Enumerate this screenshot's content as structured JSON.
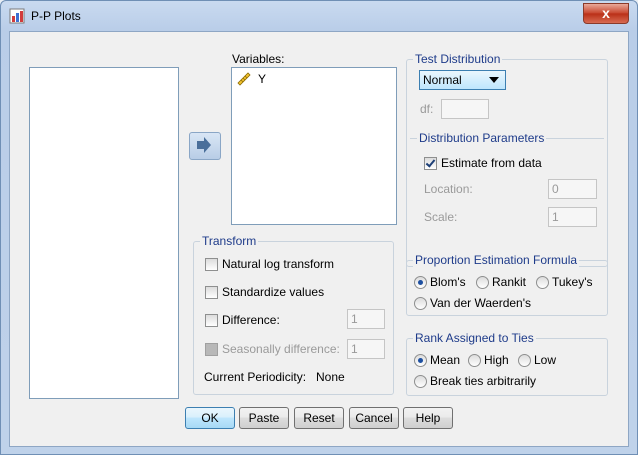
{
  "window": {
    "title": "P-P Plots",
    "close_label": "x"
  },
  "variables": {
    "label": "Variables:",
    "items": [
      {
        "name": "Y"
      }
    ]
  },
  "transform": {
    "legend": "Transform",
    "natural_log": {
      "label": "Natural log transform",
      "checked": false
    },
    "standardize": {
      "label": "Standardize values",
      "checked": false
    },
    "difference": {
      "label": "Difference:",
      "checked": false,
      "value": "1"
    },
    "seasonal": {
      "label": "Seasonally difference:",
      "checked": false,
      "value": "1",
      "disabled": true
    },
    "periodicity_label": "Current Periodicity:",
    "periodicity_value": "None"
  },
  "test_distribution": {
    "legend": "Test Distribution",
    "selected": "Normal",
    "df_label": "df:",
    "df_value": "",
    "params_legend": "Distribution Parameters",
    "estimate": {
      "label": "Estimate from data",
      "checked": true
    },
    "location_label": "Location:",
    "location_value": "0",
    "scale_label": "Scale:",
    "scale_value": "1"
  },
  "proportion": {
    "legend": "Proportion Estimation Formula",
    "options": [
      "Blom's",
      "Rankit",
      "Tukey's",
      "Van der Waerden's"
    ],
    "selected": "Blom's"
  },
  "ties": {
    "legend": "Rank Assigned to Ties",
    "options": [
      "Mean",
      "High",
      "Low",
      "Break ties arbitrarily"
    ],
    "selected": "Mean"
  },
  "buttons": {
    "ok": "OK",
    "paste": "Paste",
    "reset": "Reset",
    "cancel": "Cancel",
    "help": "Help"
  }
}
